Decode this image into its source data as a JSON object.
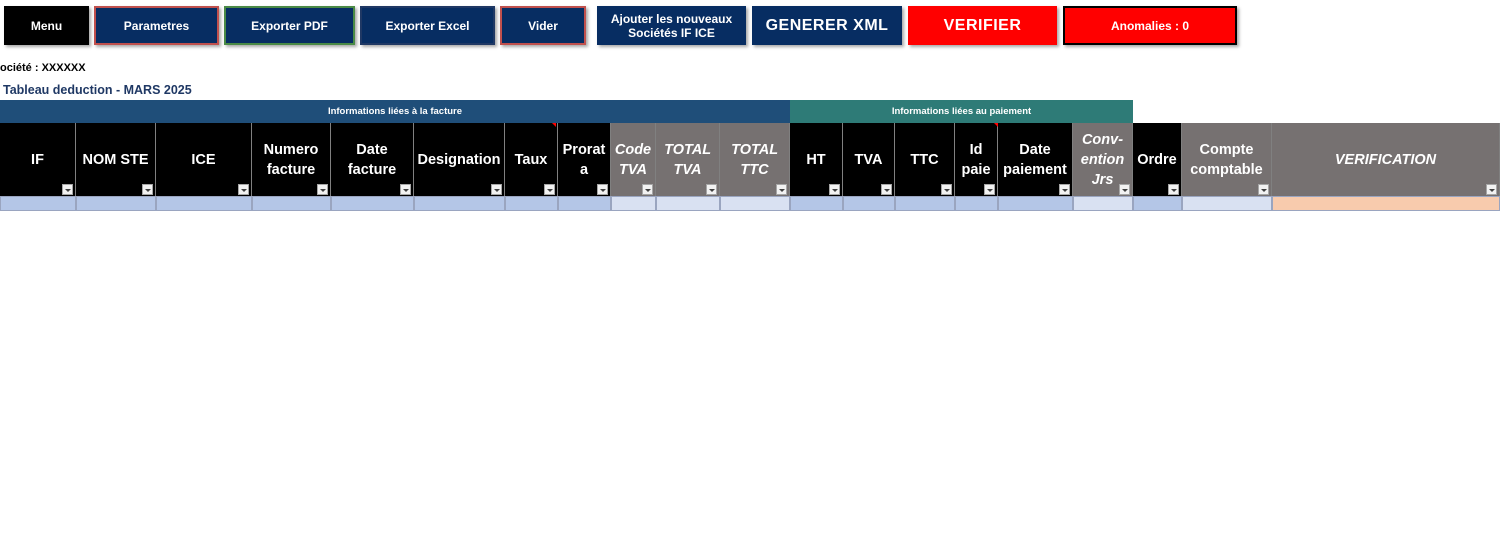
{
  "toolbar": {
    "menu": "Menu",
    "parametres": "Parametres",
    "exporter_pdf": "Exporter PDF",
    "exporter_excel": "Exporter Excel",
    "vider": "Vider",
    "ajouter_line1": "Ajouter les nouveaux",
    "ajouter_line2": "Sociétés IF  ICE",
    "generer_xml": "GENERER XML",
    "verifier": "VERIFIER",
    "anomalies": "Anomalies : 0"
  },
  "societe_label": "ociété : XXXXXX",
  "table_title": "Tableau deduction - MARS 2025",
  "groups": {
    "facture": "Informations liées à la facture",
    "paiement": "Informations liées au paiement"
  },
  "columns": {
    "if": "IF",
    "nom_ste": "NOM STE",
    "ice": "ICE",
    "numero_facture": "Numero facture",
    "date_facture": "Date facture",
    "designation": "Designation",
    "taux": "Taux",
    "prorata": "Prorat a",
    "code_tva": "Code TVA",
    "total_tva": "TOTAL TVA",
    "total_ttc": "TOTAL TTC",
    "ht": "HT",
    "tva": "TVA",
    "ttc": "TTC",
    "id_paie": "Id paie",
    "date_paiement": "Date paiement",
    "convention": "Conv-ention Jrs",
    "ordre": "Ordre",
    "compte_comptable": "Compte comptable",
    "verification": "VERIFICATION"
  },
  "colors": {
    "button_dark": "#072d62",
    "button_red": "#ff0000",
    "group_facture": "#1f4e79",
    "group_paiement": "#2e7b77",
    "header_black": "#000000",
    "header_gray": "#767171",
    "row_blue": "#b4c6e7",
    "row_light": "#d9e1f2",
    "row_orange": "#f8cbad"
  }
}
